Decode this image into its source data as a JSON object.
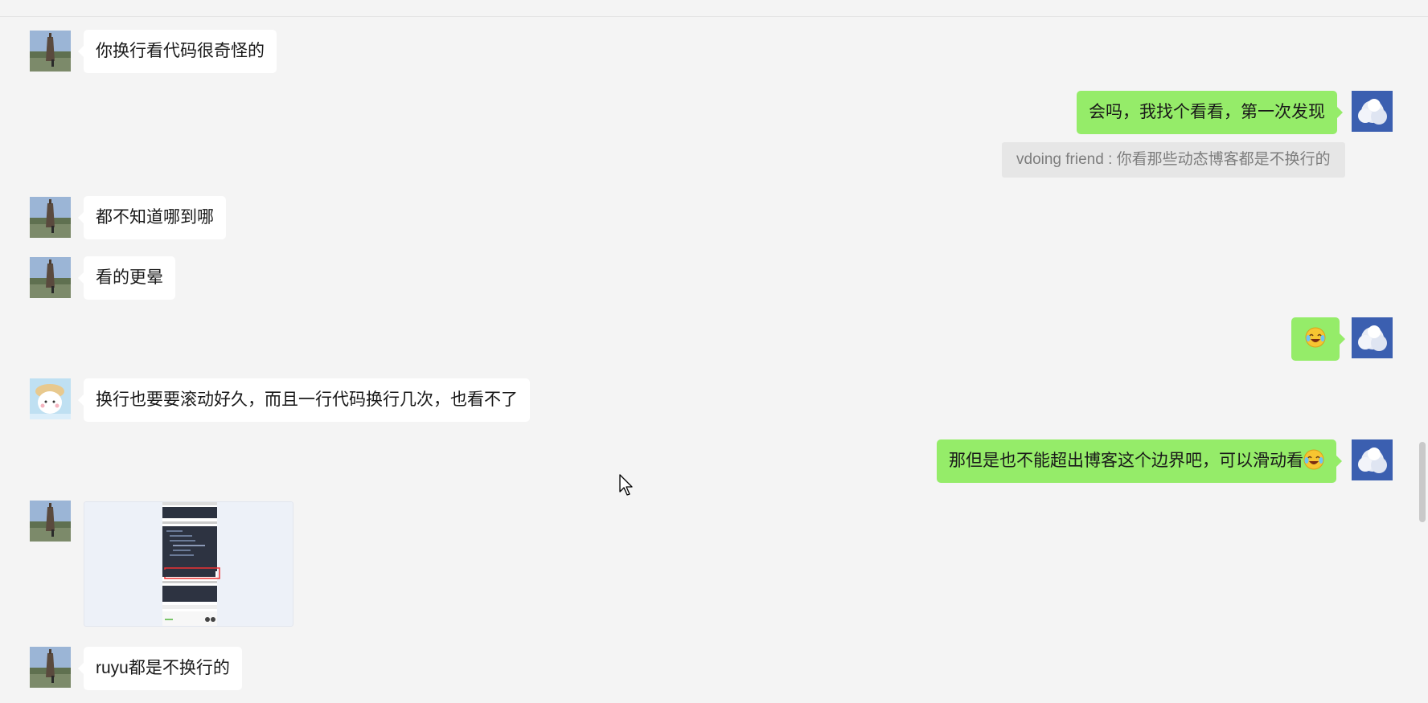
{
  "messages": [
    {
      "id": "m1",
      "side": "incoming",
      "sender": "tower-avatar",
      "text": "你换行看代码很奇怪的"
    },
    {
      "id": "m2",
      "side": "outgoing",
      "sender": "sky-avatar",
      "text": "会吗，我找个看看，第一次发现"
    },
    {
      "id": "m3",
      "type": "quote",
      "text": "vdoing friend : 你看那些动态博客都是不换行的"
    },
    {
      "id": "m4",
      "side": "incoming",
      "sender": "tower-avatar",
      "text": "都不知道哪到哪"
    },
    {
      "id": "m5",
      "side": "incoming",
      "sender": "tower-avatar",
      "text": "看的更晕"
    },
    {
      "id": "m6",
      "side": "outgoing",
      "sender": "sky-avatar",
      "emoji": "laughing-crying-emoji"
    },
    {
      "id": "m7",
      "side": "incoming",
      "sender": "cartoon-avatar",
      "text": "换行也要要滚动好久，而且一行代码换行几次，也看不了"
    },
    {
      "id": "m8",
      "side": "outgoing",
      "sender": "sky-avatar",
      "text": "那但是也不能超出博客这个边界吧，可以滑动看",
      "emoji": "laughing-crying-emoji"
    },
    {
      "id": "m9",
      "side": "incoming",
      "sender": "tower-avatar",
      "type": "image",
      "image": "code-screenshot-thumbnail"
    },
    {
      "id": "m10",
      "side": "incoming",
      "sender": "tower-avatar",
      "text": "ruyu都是不换行的"
    }
  ],
  "colors": {
    "background": "#f4f4f4",
    "incoming_bubble": "#ffffff",
    "outgoing_bubble": "#95ec69",
    "quote_bg": "#e6e6e6",
    "quote_text": "#7d7d7d"
  }
}
